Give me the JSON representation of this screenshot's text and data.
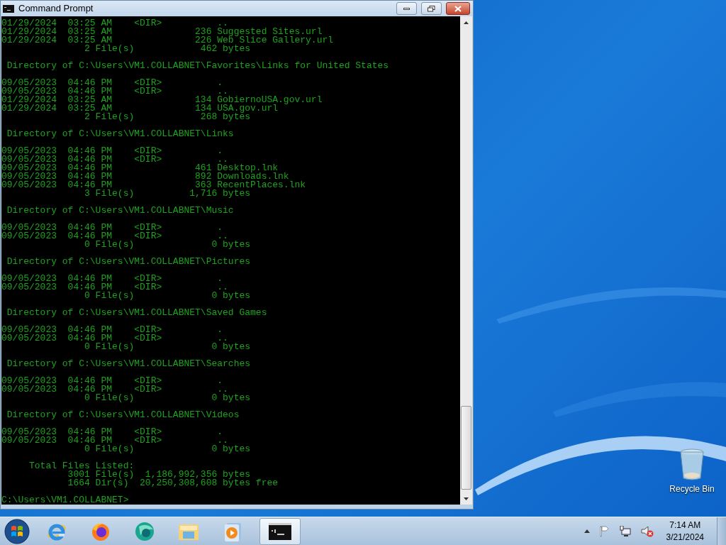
{
  "window": {
    "title": "Command Prompt"
  },
  "console": {
    "blocks": [
      [
        "01/29/2024  03:25 AM    <DIR>          ..",
        "01/29/2024  03:25 AM               236 Suggested Sites.url",
        "01/29/2024  03:25 AM               226 Web Slice Gallery.url",
        "               2 File(s)            462 bytes"
      ],
      [
        " Directory of C:\\Users\\VM1.COLLABNET\\Favorites\\Links for United States"
      ],
      [
        "09/05/2023  04:46 PM    <DIR>          .",
        "09/05/2023  04:46 PM    <DIR>          ..",
        "01/29/2024  03:25 AM               134 GobiernoUSA.gov.url",
        "01/29/2024  03:25 AM               134 USA.gov.url",
        "               2 File(s)            268 bytes"
      ],
      [
        " Directory of C:\\Users\\VM1.COLLABNET\\Links"
      ],
      [
        "09/05/2023  04:46 PM    <DIR>          .",
        "09/05/2023  04:46 PM    <DIR>          ..",
        "09/05/2023  04:46 PM               461 Desktop.lnk",
        "09/05/2023  04:46 PM               892 Downloads.lnk",
        "09/05/2023  04:46 PM               363 RecentPlaces.lnk",
        "               3 File(s)          1,716 bytes"
      ],
      [
        " Directory of C:\\Users\\VM1.COLLABNET\\Music"
      ],
      [
        "09/05/2023  04:46 PM    <DIR>          .",
        "09/05/2023  04:46 PM    <DIR>          ..",
        "               0 File(s)              0 bytes"
      ],
      [
        " Directory of C:\\Users\\VM1.COLLABNET\\Pictures"
      ],
      [
        "09/05/2023  04:46 PM    <DIR>          .",
        "09/05/2023  04:46 PM    <DIR>          ..",
        "               0 File(s)              0 bytes"
      ],
      [
        " Directory of C:\\Users\\VM1.COLLABNET\\Saved Games"
      ],
      [
        "09/05/2023  04:46 PM    <DIR>          .",
        "09/05/2023  04:46 PM    <DIR>          ..",
        "               0 File(s)              0 bytes"
      ],
      [
        " Directory of C:\\Users\\VM1.COLLABNET\\Searches"
      ],
      [
        "09/05/2023  04:46 PM    <DIR>          .",
        "09/05/2023  04:46 PM    <DIR>          ..",
        "               0 File(s)              0 bytes"
      ],
      [
        " Directory of C:\\Users\\VM1.COLLABNET\\Videos"
      ],
      [
        "09/05/2023  04:46 PM    <DIR>          .",
        "09/05/2023  04:46 PM    <DIR>          ..",
        "               0 File(s)              0 bytes"
      ],
      [
        "     Total Files Listed:",
        "            3001 File(s)  1,186,992,356 bytes",
        "            1664 Dir(s)  20,250,308,608 bytes free"
      ],
      [
        "C:\\Users\\VM1.COLLABNET>"
      ]
    ]
  },
  "desktop_icons": [
    {
      "label": "Recycle Bin",
      "kind": "recycle-bin"
    }
  ],
  "taskbar": {
    "apps": [
      {
        "kind": "ie",
        "selected": false
      },
      {
        "kind": "firefox",
        "selected": false
      },
      {
        "kind": "teal",
        "selected": false
      },
      {
        "kind": "explorer",
        "selected": false
      },
      {
        "kind": "media",
        "selected": false
      },
      {
        "kind": "cmd",
        "selected": true
      }
    ],
    "clock": {
      "time": "7:14 AM",
      "date": "3/21/2024"
    }
  }
}
